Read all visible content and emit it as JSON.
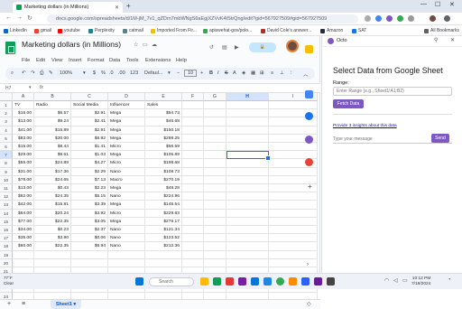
{
  "browser": {
    "tab_title": "Marketing dollars (in Millions)",
    "url": "docs.google.com/spreadsheets/d/1M-jM_7v1_qZDrn7mbWNgS6aEgjXZVvK4tStrQng/edit?gid=567927509#gid=567927509"
  },
  "bookmarks": [
    {
      "label": "LinkedIn",
      "color": "#0a66c2"
    },
    {
      "label": "gmail",
      "color": "#ea4335"
    },
    {
      "label": "youtube",
      "color": "#ff0000"
    },
    {
      "label": "Perplexity",
      "color": "#20808d"
    },
    {
      "label": "catmail",
      "color": "#607d8b"
    },
    {
      "label": "Imported From Fir...",
      "color": "#fbbc04"
    },
    {
      "label": "apiswehat-gov/polo...",
      "color": "#34a853"
    },
    {
      "label": "David Cole's answer...",
      "color": "#b92b27"
    },
    {
      "label": "Amazon",
      "color": "#232f3e"
    },
    {
      "label": "SAT",
      "color": "#1a73e8"
    },
    {
      "label": "All Bookmarks",
      "color": "#5f6368"
    }
  ],
  "sheet": {
    "title": "Marketing dollars (in Millions)",
    "menus": [
      "File",
      "Edit",
      "View",
      "Insert",
      "Format",
      "Data",
      "Tools",
      "Extensions",
      "Help"
    ],
    "zoom": "100%",
    "currency": "$",
    "percent": "%",
    "decimal_dec": ".0",
    "decimal_inc": ".00",
    "num_format": "123",
    "font": "Defaul...",
    "font_size": "10",
    "name_box": "H7",
    "fx": "fx",
    "columns": [
      "A",
      "B",
      "C",
      "D",
      "E",
      "F",
      "G",
      "H",
      "I"
    ],
    "selected_column": "H",
    "selected_row": 7,
    "rows": [
      [
        "TV",
        "Radio",
        "Social Media",
        "Influencer",
        "Sales"
      ],
      [
        "$16.00",
        "$6.57",
        "$2.91",
        "Mega",
        "$54.73"
      ],
      [
        "$13.00",
        "$9.24",
        "$2.41",
        "Mega",
        "$46.68"
      ],
      [
        "$41.00",
        "$15.89",
        "$2.91",
        "Mega",
        "$150.18"
      ],
      [
        "$83.00",
        "$30.00",
        "$6.92",
        "Mega",
        "$298.25"
      ],
      [
        "$15.00",
        "$8.44",
        "$1.41",
        "Micro",
        "$56.59"
      ],
      [
        "$29.00",
        "$9.61",
        "$1.03",
        "Mega",
        "$105.89"
      ],
      [
        "$55.00",
        "$24.89",
        "$4.27",
        "Micro",
        "$198.68"
      ],
      [
        "$31.00",
        "$17.36",
        "$2.29",
        "Nano",
        "$108.73"
      ],
      [
        "$76.00",
        "$24.65",
        "$7.13",
        "Macro",
        "$270.19"
      ],
      [
        "$13.00",
        "$0.43",
        "$2.23",
        "Mega",
        "$48.28"
      ],
      [
        "$62.00",
        "$24.35",
        "$5.15",
        "Nano",
        "$224.96"
      ],
      [
        "$42.00",
        "$15.81",
        "$3.39",
        "Mega",
        "$145.54"
      ],
      [
        "$64.00",
        "$20.24",
        "$3.92",
        "Micro",
        "$229.63"
      ],
      [
        "$77.00",
        "$22.35",
        "$3.05",
        "Mega",
        "$276.17"
      ],
      [
        "$34.00",
        "$0.23",
        "$2.37",
        "Nano",
        "$121.34"
      ],
      [
        "$35.00",
        "$3.90",
        "$0.06",
        "Nano",
        "$123.52"
      ],
      [
        "$60.00",
        "$22.35",
        "$6.94",
        "Nano",
        "$212.36"
      ]
    ],
    "sheet_tab": "Sheet1"
  },
  "panel": {
    "app_name": "Octo",
    "heading": "Select Data from Google Sheet",
    "range_label": "Range:",
    "range_placeholder": "Enter Range (e.g., Sheet1!A1:B2)",
    "fetch_label": "Fetch Data",
    "link_text": "Provide 3 insights about this data",
    "message_placeholder": "Type your message",
    "send_label": "Send"
  },
  "taskbar": {
    "weather_temp": "77°F",
    "weather_desc": "Clear",
    "search_label": "Search",
    "time": "10:12 PM",
    "date": "7/18/2024"
  }
}
